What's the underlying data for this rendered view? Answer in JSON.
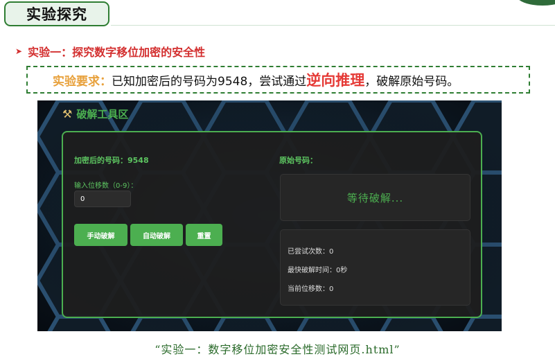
{
  "slide": {
    "title": "实验探究",
    "experiment_heading": "实验一：探究数字移位加密的安全性",
    "requirement": {
      "label": "实验要求：",
      "text_before": "已知加密后的号码为9548，尝试通过",
      "emphasis": "逆向推理",
      "text_after": "，破解原始号码。"
    },
    "caption": "“实验一：数字移位加密安全性测试网页.html”"
  },
  "tool": {
    "heading": "破解工具区",
    "encrypted_label": "加密后的号码：9548",
    "shift_label": "输入位移数（0-9）：",
    "shift_value": "0",
    "buttons": {
      "manual": "手动破解",
      "auto": "自动破解",
      "reset": "重置"
    },
    "original_label": "原始号码：",
    "original_value": "等待破解...",
    "stats": {
      "attempts": "已尝试次数：0",
      "fastest_time": "最快破解时间：0秒",
      "current_shift": "当前位移数：0"
    }
  },
  "colors": {
    "accent_green": "#4caf50",
    "title_border": "#2e7d32",
    "experiment_red": "#d32f2f",
    "requirement_label": "#e8a13c",
    "emphasis_red": "#e53935",
    "panel_bg": "#1e1e1e"
  },
  "icons": {
    "tool_heading": "tools-icon",
    "bullet": "arrow-right-icon"
  }
}
